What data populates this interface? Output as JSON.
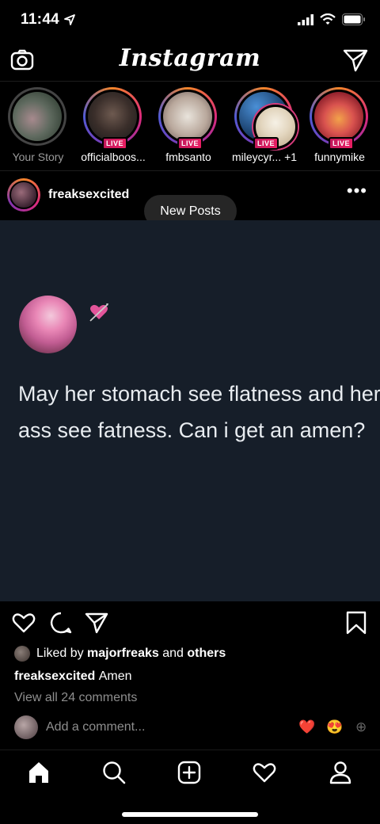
{
  "status": {
    "time": "11:44"
  },
  "header": {
    "title": "Instagram"
  },
  "stories": [
    {
      "name": "Your Story",
      "live": false,
      "live_label": ""
    },
    {
      "name": "officialboos...",
      "live": true,
      "live_label": "LIVE"
    },
    {
      "name": "fmbsanto",
      "live": true,
      "live_label": "LIVE"
    },
    {
      "name": "mileycyr... +1",
      "live": true,
      "live_label": "LIVE"
    },
    {
      "name": "funnymike",
      "live": true,
      "live_label": "LIVE"
    }
  ],
  "post": {
    "username": "freaksexcited",
    "more": "•••",
    "new_posts": "New Posts",
    "image_text": "May her stomach see flatness and her ass see fatness. Can i get an amen?",
    "liked_prefix": "Liked by",
    "liked_user": "majorfreaks",
    "liked_and": "and",
    "liked_others": "others",
    "caption_user": "freaksexcited",
    "caption_text": "Amen",
    "view_comments": "View all 24 comments",
    "add_comment": "Add a comment...",
    "quick_reactions": [
      "❤️",
      "😍",
      "⊕"
    ]
  },
  "icons": {
    "camera": "camera-icon",
    "direct": "paper-plane-icon",
    "like": "heart-icon",
    "comment": "comment-icon",
    "share": "paper-plane-icon",
    "save": "bookmark-icon",
    "home": "home-icon",
    "search": "search-icon",
    "new_post": "plus-square-icon",
    "activity": "heart-icon",
    "profile": "person-icon"
  },
  "colors": {
    "background": "#000000",
    "post_image_bg": "#161e29",
    "live_badge": "#e91e63",
    "muted_text": "#8e8e8e"
  }
}
